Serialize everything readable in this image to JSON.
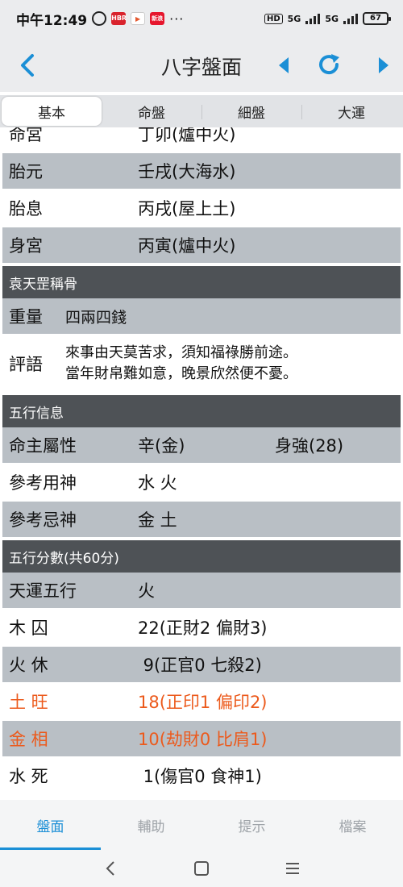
{
  "status_bar": {
    "time": "中午12:49",
    "app_badges": [
      "HBR",
      "▶",
      "新浪"
    ],
    "more": "···",
    "hd": "HD",
    "network1": "5G",
    "network2": "5G",
    "battery": "67"
  },
  "header": {
    "title": "八字盤面"
  },
  "tabs": [
    {
      "label": "基本",
      "active": true
    },
    {
      "label": "命盤",
      "active": false
    },
    {
      "label": "細盤",
      "active": false
    },
    {
      "label": "大運",
      "active": false
    }
  ],
  "basic": {
    "rows": [
      {
        "key": "命宮",
        "value": "丁卯(爐中火)"
      },
      {
        "key": "胎元",
        "value": "壬戌(大海水)"
      },
      {
        "key": "胎息",
        "value": "丙戌(屋上土)"
      },
      {
        "key": "身宮",
        "value": "丙寅(爐中火)"
      }
    ]
  },
  "yuan_tiangang": {
    "title": "袁天罡稱骨",
    "weight_key": "重量",
    "weight_value": "四兩四錢",
    "comment_key": "評語",
    "comment_line1": "來事由天莫苦求，須知福祿勝前途。",
    "comment_line2": "當年財帛難如意，晚景欣然便不憂。"
  },
  "wuxing_info": {
    "title": "五行信息",
    "rows": [
      {
        "key": "命主屬性",
        "value": "辛(金)",
        "extra": "身強(28)"
      },
      {
        "key": "參考用神",
        "value": "水 火"
      },
      {
        "key": "參考忌神",
        "value": "金 土"
      }
    ]
  },
  "wuxing_score": {
    "title": "五行分數(共60分)",
    "rows": [
      {
        "key": "天運五行",
        "value": "火",
        "highlight": false
      },
      {
        "key": "木 囚",
        "value": "22(正財2 偏財3)",
        "highlight": false
      },
      {
        "key": "火 休",
        "value": " 9(正官0 七殺2)",
        "highlight": false
      },
      {
        "key": "土 旺",
        "value": "18(正印1 偏印2)",
        "highlight": true
      },
      {
        "key": "金 相",
        "value": "10(劫財0 比肩1)",
        "highlight": true
      },
      {
        "key": "水 死",
        "value": " 1(傷官0 食神1)",
        "highlight": false
      }
    ]
  },
  "bottom_nav": [
    {
      "label": "盤面",
      "active": true
    },
    {
      "label": "輔助",
      "active": false
    },
    {
      "label": "提示",
      "active": false
    },
    {
      "label": "檔案",
      "active": false
    }
  ],
  "colors": {
    "accent": "#1b8fd6",
    "highlight": "#ec5a1c",
    "section_bg": "#4e5256",
    "row_grey": "#b9bfc5"
  },
  "icons": {
    "back": "chevron-left-icon",
    "prev": "triangle-left-icon",
    "refresh": "refresh-icon",
    "next": "triangle-right-icon"
  }
}
